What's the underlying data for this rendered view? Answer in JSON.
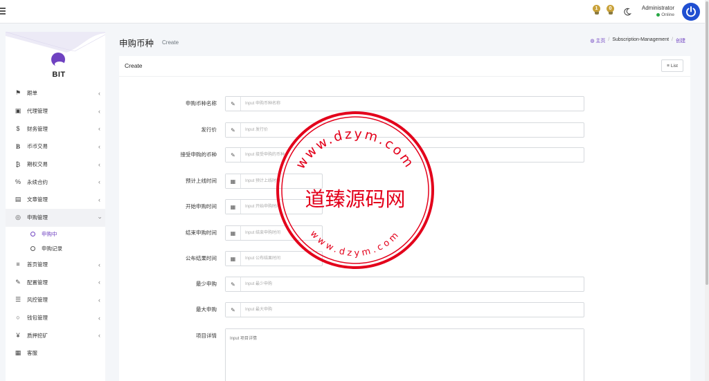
{
  "topbar": {
    "notifications": [
      {
        "count": "1"
      },
      {
        "count": "0"
      }
    ],
    "user_name": "Administrator",
    "user_status": "Online"
  },
  "sidebar": {
    "brand": "BIT",
    "items": [
      {
        "label": "跟单",
        "icon": "flag-icon",
        "glyph": "⚑"
      },
      {
        "label": "代理管理",
        "icon": "id-card-icon",
        "glyph": "▣"
      },
      {
        "label": "财务管理",
        "icon": "dollar-icon",
        "glyph": "$"
      },
      {
        "label": "币币交易",
        "icon": "bold-b-icon",
        "glyph": "B"
      },
      {
        "label": "期权交易",
        "icon": "bitcoin-icon",
        "glyph": "₿"
      },
      {
        "label": "永续合约",
        "icon": "percent-icon",
        "glyph": "%"
      },
      {
        "label": "文章管理",
        "icon": "newspaper-icon",
        "glyph": "▤"
      },
      {
        "label": "申购管理",
        "icon": "lifebuoy-icon",
        "glyph": "◎"
      },
      {
        "label": "首页管理",
        "icon": "bars-icon",
        "glyph": "≡"
      },
      {
        "label": "配置管理",
        "icon": "wrench-icon",
        "glyph": "✎"
      },
      {
        "label": "风控管理",
        "icon": "list-icon",
        "glyph": "☰"
      },
      {
        "label": "钱包管理",
        "icon": "circle-icon",
        "glyph": "○"
      },
      {
        "label": "质押挖矿",
        "icon": "yen-icon",
        "glyph": "¥"
      },
      {
        "label": "客服",
        "icon": "contact-card-icon",
        "glyph": "▦"
      }
    ],
    "sub_items": [
      {
        "label": "申购中",
        "active": true
      },
      {
        "label": "申购记录",
        "active": false
      }
    ]
  },
  "header": {
    "title": "申购币种",
    "subtitle": "Create",
    "breadcrumb": {
      "home": "主页",
      "section": "Subscription-Management",
      "current": "创建"
    }
  },
  "card": {
    "title": "Create",
    "list_button": "List"
  },
  "form": {
    "fields": [
      {
        "label": "申购币种名称",
        "placeholder": "Input 申购币种名称"
      },
      {
        "label": "发行价",
        "placeholder": "Input 发行价"
      },
      {
        "label": "接受申购的币种",
        "placeholder": "Input 接受申购的币种"
      },
      {
        "label": "预计上线时间",
        "placeholder": "Input 预计上线时间"
      },
      {
        "label": "开始申购时间",
        "placeholder": "Input 开始申购时间"
      },
      {
        "label": "结束申购时间",
        "placeholder": "Input 结束申购时间"
      },
      {
        "label": "公布结果时间",
        "placeholder": "Input 公布结果时间"
      },
      {
        "label": "最少申购",
        "placeholder": "Input 最少申购"
      },
      {
        "label": "最大申购",
        "placeholder": "Input 最大申购"
      },
      {
        "label": "项目详情",
        "placeholder": "Input 项目详情"
      }
    ]
  },
  "watermark": {
    "center_text": "道臻源码网",
    "ring_text": "www.dzym.com"
  },
  "colors": {
    "accent": "#6f42c1",
    "stamp": "#e3001b",
    "avatar": "#1f4fd1"
  }
}
